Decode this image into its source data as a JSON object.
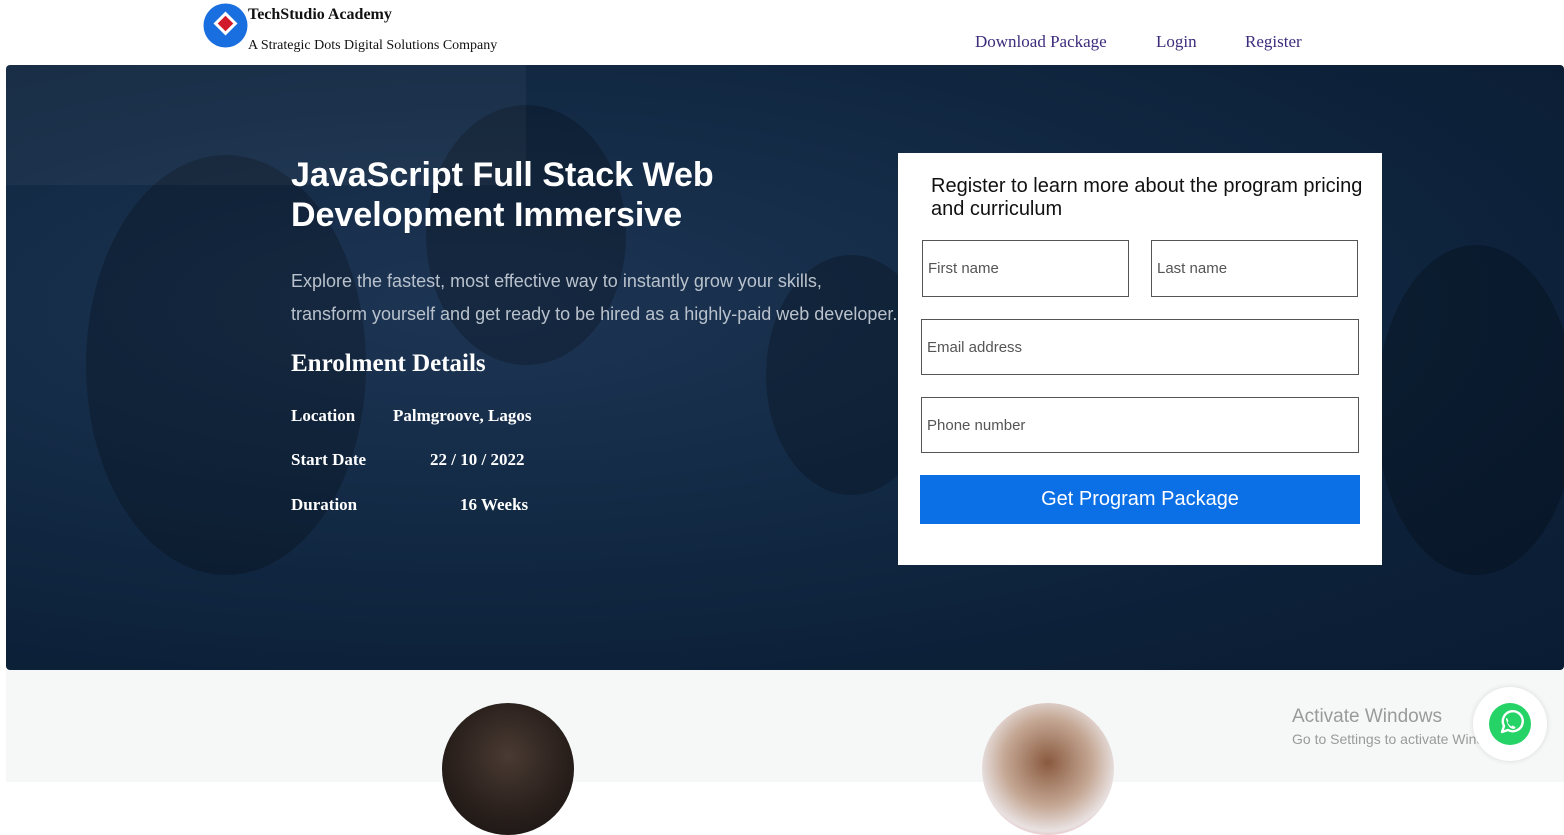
{
  "header": {
    "brand": "TechStudio Academy",
    "tagline": "A Strategic Dots Digital Solutions Company",
    "nav": [
      "Download Package",
      "Login",
      "Register"
    ]
  },
  "hero": {
    "title": "JavaScript Full Stack Web Development Immersive",
    "description": "Explore the fastest, most effective way to instantly grow your skills, transform yourself and get ready to be hired as a highly-paid web developer.",
    "enrolment_title": "Enrolment Details",
    "details": [
      {
        "label": "Location",
        "value": "Palmgroove, Lagos"
      },
      {
        "label": "Start Date",
        "value": "22 / 10 / 2022"
      },
      {
        "label": "Duration",
        "value": "16 Weeks"
      }
    ]
  },
  "form": {
    "title": "Register to learn more about the program pricing and curriculum",
    "first_name_placeholder": "First name",
    "last_name_placeholder": "Last name",
    "email_placeholder": "Email address",
    "phone_placeholder": "Phone number",
    "submit_label": "Get Program Package",
    "submit_color": "#0b6fe6"
  },
  "overlay": {
    "activate_title": "Activate Windows",
    "activate_sub": "Go to Settings to activate Windows.",
    "chat_icon": "whatsapp-icon"
  },
  "colors": {
    "nav_link": "#3d2b7c",
    "hero_bg": "#0f2640",
    "logo_blue": "#1a6fe0",
    "logo_red": "#d11a2a"
  }
}
